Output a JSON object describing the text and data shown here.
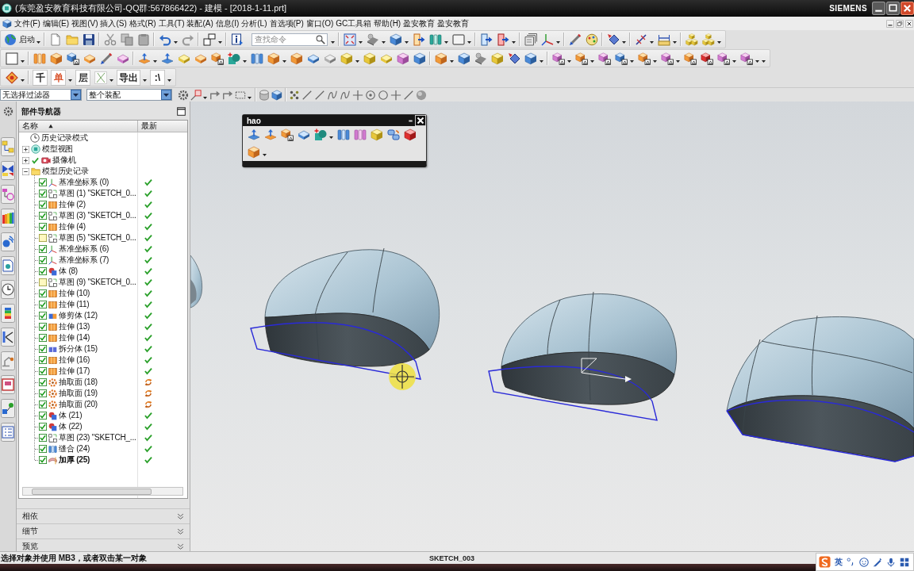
{
  "window": {
    "title": "(东莞盈安教育科技有限公司-QQ群:567866422) - 建模 - [2018-1-11.prt]",
    "brand": "SIEMENS"
  },
  "menu": [
    "文件(F)",
    "编辑(E)",
    "视图(V)",
    "插入(S)",
    "格式(R)",
    "工具(T)",
    "装配(A)",
    "信息(I)",
    "分析(L)",
    "首选项(P)",
    "窗口(O)",
    "GC工具箱",
    "帮助(H)",
    "盈安教育",
    "盈安教育"
  ],
  "toolbar": {
    "start": "启动",
    "search": {
      "placeholder": "查找命令"
    },
    "glyph_buttons": [
      {
        "label": "千",
        "color": "#1a1a1a"
      },
      {
        "label": "单",
        "color": "#d9532c"
      },
      {
        "label": "层",
        "color": "#333333"
      },
      {
        "label": "导出",
        "color": "#222222"
      },
      {
        "label": ":\\",
        "color": "#111111"
      }
    ]
  },
  "selection_bar": {
    "filter": "无选择过滤器",
    "scope": "整个装配"
  },
  "navigator": {
    "title": "部件导航器",
    "columns": [
      {
        "label": "名称",
        "sorted": true
      },
      {
        "label": "最新",
        "sorted": false
      }
    ],
    "mode_row": {
      "label": "历史记录模式"
    },
    "nodes": [
      {
        "label": "模型视图",
        "kind": "views",
        "expanded": false,
        "visible": false
      },
      {
        "label": "摄像机",
        "kind": "camera",
        "expanded": false,
        "visible": true
      },
      {
        "label": "模型历史记录",
        "kind": "folder",
        "expanded": true,
        "visible": false,
        "children": [
          {
            "label": "基准坐标系 (0)",
            "kind": "datum",
            "checked": true,
            "up_to_date": true,
            "current": false
          },
          {
            "label": "草图 (1) \"SKETCH_0...",
            "kind": "sketch",
            "checked": true,
            "up_to_date": true,
            "current": false
          },
          {
            "label": "拉伸 (2)",
            "kind": "extrude",
            "checked": true,
            "up_to_date": true,
            "current": false
          },
          {
            "label": "草图 (3) \"SKETCH_0...",
            "kind": "sketch",
            "checked": true,
            "up_to_date": true,
            "current": false
          },
          {
            "label": "拉伸 (4)",
            "kind": "extrude",
            "checked": true,
            "up_to_date": true,
            "current": false
          },
          {
            "label": "草图 (5) \"SKETCH_0...",
            "kind": "sketch",
            "checked": false,
            "up_to_date": true,
            "current": false
          },
          {
            "label": "基准坐标系 (6)",
            "kind": "datum",
            "checked": true,
            "up_to_date": true,
            "current": false
          },
          {
            "label": "基准坐标系 (7)",
            "kind": "datum",
            "checked": true,
            "up_to_date": true,
            "current": false
          },
          {
            "label": "体 (8)",
            "kind": "body",
            "checked": true,
            "up_to_date": true,
            "current": false
          },
          {
            "label": "草图 (9) \"SKETCH_0...",
            "kind": "sketch",
            "checked": false,
            "up_to_date": true,
            "current": false
          },
          {
            "label": "拉伸 (10)",
            "kind": "extrude",
            "checked": true,
            "up_to_date": true,
            "current": false
          },
          {
            "label": "拉伸 (11)",
            "kind": "extrude",
            "checked": true,
            "up_to_date": true,
            "current": false
          },
          {
            "label": "修剪体 (12)",
            "kind": "trim",
            "checked": true,
            "up_to_date": true,
            "current": false
          },
          {
            "label": "拉伸 (13)",
            "kind": "extrude",
            "checked": true,
            "up_to_date": true,
            "current": false
          },
          {
            "label": "拉伸 (14)",
            "kind": "extrude",
            "checked": true,
            "up_to_date": true,
            "current": false
          },
          {
            "label": "拆分体 (15)",
            "kind": "split",
            "checked": true,
            "up_to_date": true,
            "current": false
          },
          {
            "label": "拉伸 (16)",
            "kind": "extrude",
            "checked": true,
            "up_to_date": true,
            "current": false
          },
          {
            "label": "拉伸 (17)",
            "kind": "extrude",
            "checked": true,
            "up_to_date": true,
            "current": false
          },
          {
            "label": "抽取面 (18)",
            "kind": "extract",
            "checked": true,
            "up_to_date": false,
            "current": false
          },
          {
            "label": "抽取面 (19)",
            "kind": "extract",
            "checked": true,
            "up_to_date": false,
            "current": false
          },
          {
            "label": "抽取面 (20)",
            "kind": "extract",
            "checked": true,
            "up_to_date": false,
            "current": false
          },
          {
            "label": "体 (21)",
            "kind": "body",
            "checked": true,
            "up_to_date": true,
            "current": false
          },
          {
            "label": "体 (22)",
            "kind": "body",
            "checked": true,
            "up_to_date": true,
            "current": false
          },
          {
            "label": "草图 (23) \"SKETCH_...",
            "kind": "sketch",
            "checked": true,
            "up_to_date": true,
            "current": false
          },
          {
            "label": "缝合 (24)",
            "kind": "sew",
            "checked": true,
            "up_to_date": true,
            "current": false
          },
          {
            "label": "加厚 (25)",
            "kind": "thicken",
            "checked": true,
            "up_to_date": true,
            "current": true
          }
        ]
      }
    ],
    "sections": [
      {
        "label": "相依",
        "expanded": false
      },
      {
        "label": "细节",
        "expanded": false
      },
      {
        "label": "预览",
        "expanded": false
      }
    ]
  },
  "floating_toolbar": {
    "title": "hao"
  },
  "status_bar": {
    "prompt": "选择对象并使用 MB3，或者双击某一对象",
    "object": "SKETCH_003"
  },
  "ime": {
    "mode": "英"
  }
}
